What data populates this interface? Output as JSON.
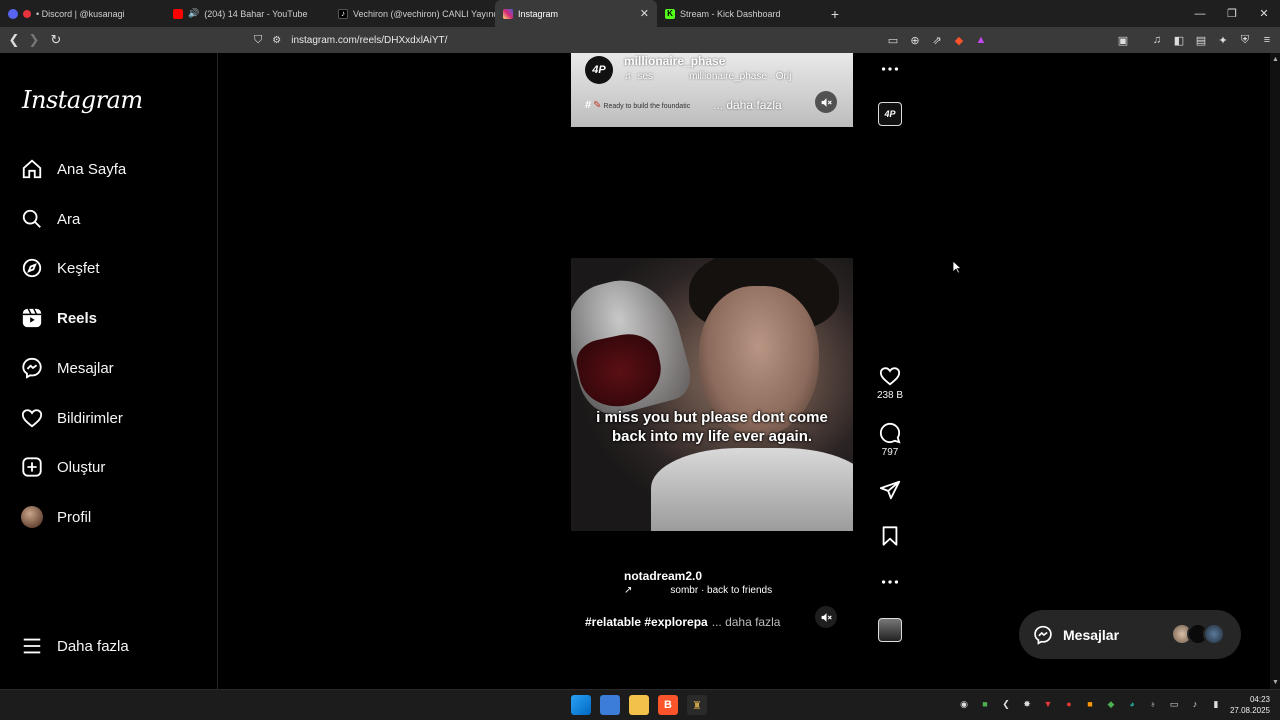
{
  "browser": {
    "tabs": [
      {
        "title": "• Discord | @kusanagi",
        "color": "#5865F2",
        "active": false
      },
      {
        "title": "(204) 14 Bahar - YouTube",
        "color": "#FF0000",
        "active": false
      },
      {
        "title": "Vechiron (@vechiron) CANLI Yayında",
        "color": "#000000",
        "active": false
      },
      {
        "title": "Instagram",
        "color": "#E1306C",
        "active": true
      },
      {
        "title": "Stream - Kick Dashboard",
        "color": "#53FC18",
        "active": false
      }
    ],
    "url": "instagram.com/reels/DHXxdxlAiYT/"
  },
  "sidebar": {
    "logo": "Instagram",
    "items": [
      {
        "label": "Ana Sayfa",
        "icon": "home-icon"
      },
      {
        "label": "Ara",
        "icon": "search-icon"
      },
      {
        "label": "Keşfet",
        "icon": "compass-icon"
      },
      {
        "label": "Reels",
        "icon": "reels-icon"
      },
      {
        "label": "Mesajlar",
        "icon": "messenger-icon"
      },
      {
        "label": "Bildirimler",
        "icon": "heart-icon"
      },
      {
        "label": "Oluştur",
        "icon": "plus-square-icon"
      },
      {
        "label": "Profil",
        "icon": "avatar"
      }
    ],
    "more_label": "Daha fazla"
  },
  "reel_prev": {
    "username": "millionaire_phase",
    "audio_label": "ses",
    "audio_source": "millionaire_phase · Orij",
    "hash_prefix": "#",
    "hash_text": "Ready to build the foundatic",
    "more": "... daha fazla",
    "avatar_text": "4P"
  },
  "reel": {
    "caption_overlay": "i miss you but please dont come back into my life ever again.",
    "username": "notadream2.0",
    "audio_arrow": "↗",
    "audio_source": "sombr · back to friends",
    "tags_bold": "#relatable #explorepa",
    "more": "... daha fazla",
    "likes": "238 B",
    "comments": "797"
  },
  "messages_pill": {
    "label": "Mesajlar"
  },
  "taskbar": {
    "time": "04:23",
    "date": "27.08.2025"
  }
}
